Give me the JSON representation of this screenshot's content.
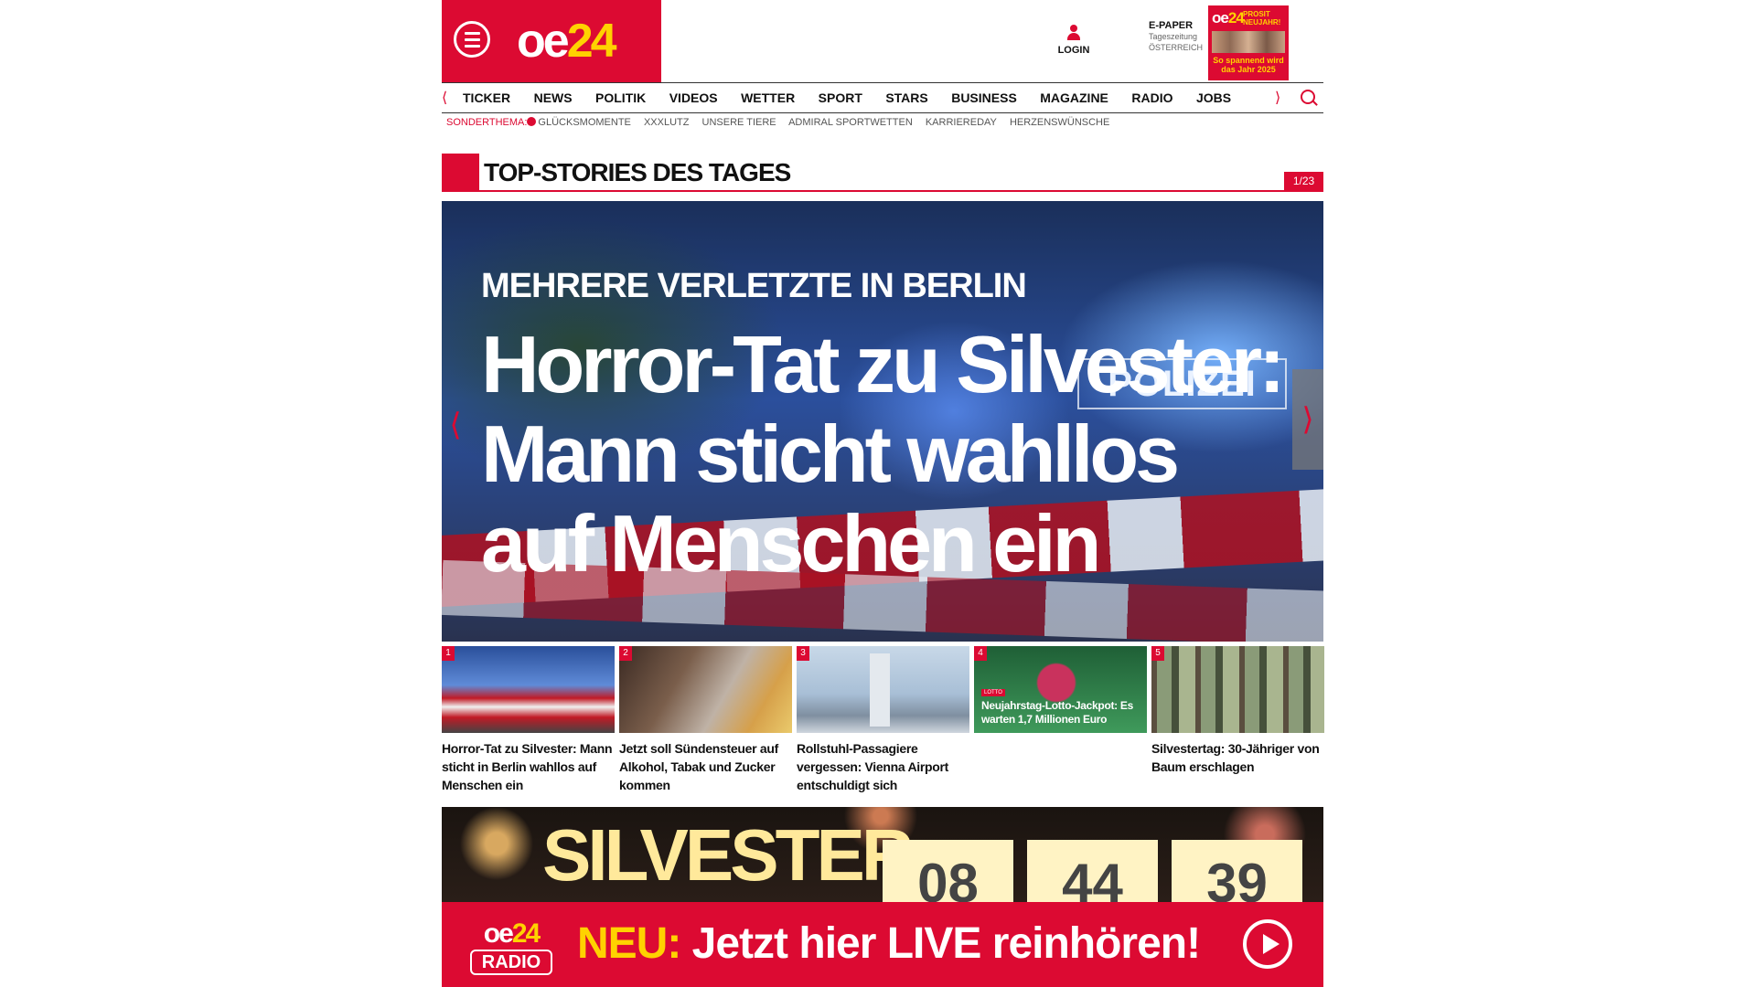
{
  "header": {
    "logo": "oe24",
    "login_label": "LOGIN",
    "epaper": {
      "title": "E-PAPER",
      "line1": "Tageszeitung",
      "line2": "ÖSTERREICH"
    },
    "cover": {
      "logo": "oe24",
      "headline": "PROSIT NEUJAHR!",
      "teaser": "So spannend wird das Jahr 2025"
    }
  },
  "nav": {
    "items": [
      "TICKER",
      "NEWS",
      "POLITIK",
      "VIDEOS",
      "WETTER",
      "SPORT",
      "STARS",
      "BUSINESS",
      "MAGAZINE",
      "RADIO",
      "JOBS"
    ]
  },
  "subnav": {
    "label": "SONDERTHEMA:",
    "items": [
      "GLÜCKSMOMENTE",
      "XXXLUTZ",
      "UNSERE TIERE",
      "ADMIRAL SPORTWETTEN",
      "KARRIEREDAY",
      "HERZENSWÜNSCHE"
    ]
  },
  "section": {
    "title": "TOP-STORIES DES TAGES",
    "counter": "1/23"
  },
  "hero": {
    "kicker": "MEHRERE VERLETZTE IN BERLIN",
    "headline": "Horror-Tat zu Silvester: Mann sticht wahllos auf Menschen ein",
    "image_text": "POLIZEI"
  },
  "stories": [
    {
      "num": "1",
      "caption": "Horror-Tat zu Silvester: Mann sticht in Berlin wahllos auf Menschen ein"
    },
    {
      "num": "2",
      "caption": "Jetzt soll Sündensteuer auf Alkohol, Tabak und Zucker kommen"
    },
    {
      "num": "3",
      "caption": "Rollstuhl-Passagiere vergessen: Vienna Airport entschuldigt sich"
    },
    {
      "num": "4",
      "caption": "",
      "overlay": "Neujahrstag-Lotto-Jackpot: Es warten 1,7 Millionen Euro",
      "tag": "LOTTO"
    },
    {
      "num": "5",
      "caption": "Silvestertag: 30-Jähriger von Baum erschlagen"
    }
  ],
  "countdown": {
    "word": "SILVESTER",
    "hours": "08",
    "minutes": "44",
    "seconds": "39"
  },
  "radio": {
    "logo_top": "oe24",
    "logo_bottom": "RADIO",
    "neu": "NEU:",
    "text": "Jetzt hier LIVE reinhören!"
  },
  "colors": {
    "brand_red": "#dc0a32",
    "accent_yellow": "#ffd200"
  }
}
